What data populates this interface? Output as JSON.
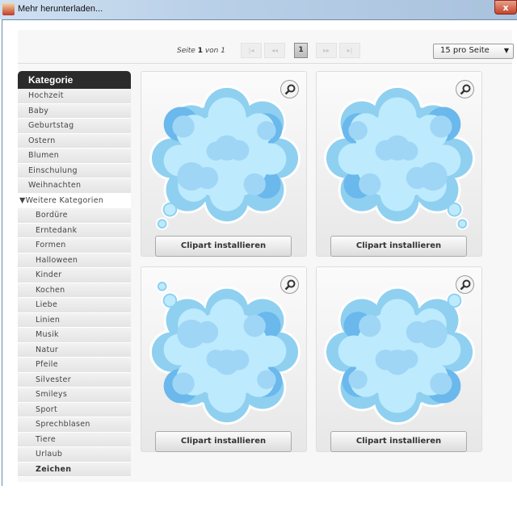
{
  "window": {
    "title": "Mehr herunterladen...",
    "close": "x"
  },
  "pager": {
    "prefix": "Seite",
    "page": "1",
    "of": "von",
    "total": "1",
    "first": "|◂",
    "prev": "◂◂",
    "current": "1",
    "next": "▸▸",
    "last": "▸|",
    "per_page": "15 pro Seite"
  },
  "sidebar": {
    "header": "Kategorie",
    "items": [
      "Hochzeit",
      "Baby",
      "Geburtstag",
      "Ostern",
      "Blumen",
      "Einschulung",
      "Weihnachten"
    ],
    "more": "Weitere Kategorien",
    "subitems": [
      "Bordüre",
      "Erntedank",
      "Formen",
      "Halloween",
      "Kinder",
      "Kochen",
      "Liebe",
      "Linien",
      "Musik",
      "Natur",
      "Pfeile",
      "Silvester",
      "Smileys",
      "Sport",
      "Sprechblasen",
      "Tiere",
      "Urlaub",
      "Zeichen"
    ]
  },
  "cards": [
    {
      "button": "Clipart installieren"
    },
    {
      "button": "Clipart installieren"
    },
    {
      "button": "Clipart installieren"
    },
    {
      "button": "Clipart installieren"
    }
  ]
}
